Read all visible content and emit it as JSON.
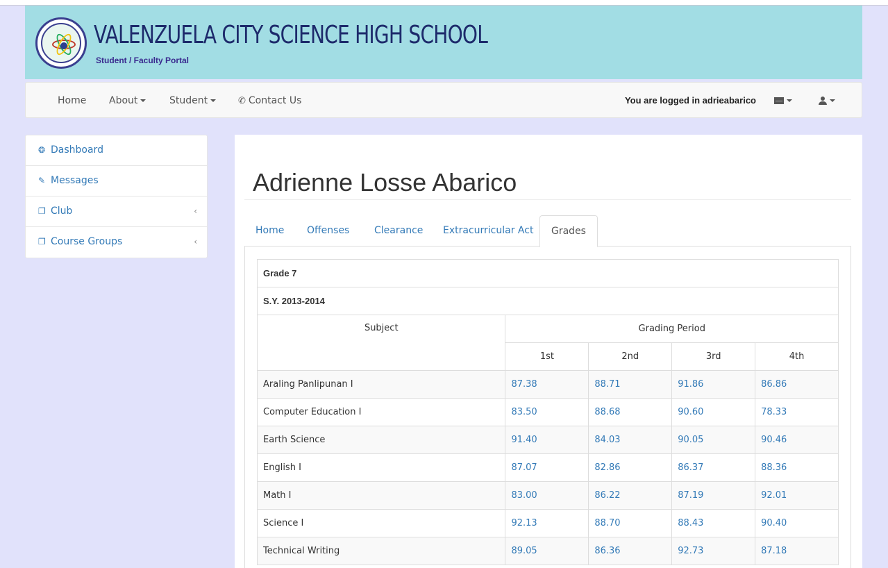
{
  "header": {
    "school_name": "VALENZUELA CITY SCIENCE HIGH SCHOOL",
    "subtitle": "Student / Faculty Portal"
  },
  "navbar": {
    "items": [
      "Home",
      "About",
      "Student",
      "Contact Us"
    ],
    "logged_in_text": "You are logged in adrieabarico"
  },
  "sidebar": {
    "items": [
      {
        "label": "Dashboard",
        "icon": "dashboard-icon"
      },
      {
        "label": "Messages",
        "icon": "edit-icon"
      },
      {
        "label": "Club",
        "icon": "copy-icon",
        "has_chevron": true
      },
      {
        "label": "Course Groups",
        "icon": "copy-icon",
        "has_chevron": true
      }
    ]
  },
  "main": {
    "student_name": "Adrienne Losse Abarico",
    "tabs": [
      "Home",
      "Offenses",
      "Clearance",
      "Extracurricular Act",
      "Grades"
    ],
    "active_tab": "Grades",
    "grades": {
      "grade_level": "Grade 7",
      "school_year": "S.Y. 2013-2014",
      "subject_header": "Subject",
      "period_header": "Grading Period",
      "periods": [
        "1st",
        "2nd",
        "3rd",
        "4th"
      ],
      "rows": [
        {
          "subject": "Araling Panlipunan I",
          "values": [
            "87.38",
            "88.71",
            "91.86",
            "86.86"
          ]
        },
        {
          "subject": "Computer Education I",
          "values": [
            "83.50",
            "88.68",
            "90.60",
            "78.33"
          ]
        },
        {
          "subject": "Earth Science",
          "values": [
            "91.40",
            "84.03",
            "90.05",
            "90.46"
          ]
        },
        {
          "subject": "English I",
          "values": [
            "87.07",
            "82.86",
            "86.37",
            "88.36"
          ]
        },
        {
          "subject": "Math I",
          "values": [
            "83.00",
            "86.22",
            "87.19",
            "92.01"
          ]
        },
        {
          "subject": "Science I",
          "values": [
            "92.13",
            "88.70",
            "88.43",
            "90.40"
          ]
        },
        {
          "subject": "Technical Writing",
          "values": [
            "89.05",
            "86.36",
            "92.73",
            "87.18"
          ]
        }
      ]
    }
  },
  "colors": {
    "header_bg": "#a2dde4",
    "page_bg": "#e1e2fb",
    "link": "#337ab7"
  }
}
